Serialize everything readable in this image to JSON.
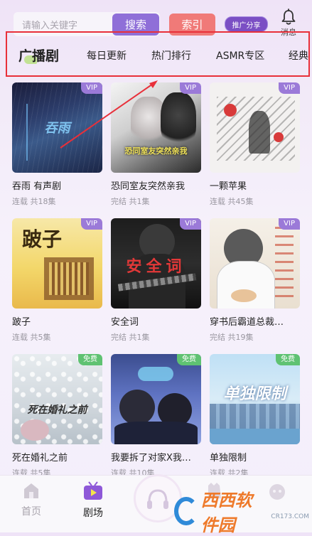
{
  "search": {
    "placeholder": "请输入关键字",
    "button": "搜索"
  },
  "header": {
    "index_button": "索引",
    "share_button": "推广分享",
    "messages_label": "消息"
  },
  "tabs": [
    "广播剧",
    "每日更新",
    "热门排行",
    "ASMR专区",
    "经典"
  ],
  "items": [
    {
      "title": "吞雨 有声剧",
      "status": "连载 共18集",
      "badge": "VIP",
      "cover_text": "吞雨"
    },
    {
      "title": "恐同室友突然亲我",
      "status": "完结 共1集",
      "badge": "VIP",
      "cover_text": "恐同室友突然亲我"
    },
    {
      "title": "一颗苹果",
      "status": "连载 共45集",
      "badge": "VIP",
      "cover_text": ""
    },
    {
      "title": "跛子",
      "status": "连载 共5集",
      "badge": "VIP",
      "cover_text": "跛子"
    },
    {
      "title": "安全词",
      "status": "完结 共1集",
      "badge": "VIP",
      "cover_text": "安全词"
    },
    {
      "title": "穿书后霸道总裁…",
      "status": "完结 共19集",
      "badge": "VIP",
      "cover_text": ""
    },
    {
      "title": "死在婚礼之前",
      "status": "连载 共5集",
      "badge": "免费",
      "cover_text": "死在婚礼之前"
    },
    {
      "title": "我要拆了对家X我…",
      "status": "连载 共10集",
      "badge": "免费",
      "cover_text": ""
    },
    {
      "title": "单独限制",
      "status": "连载 共2集",
      "badge": "免费",
      "cover_text": "单独限制"
    }
  ],
  "nav": {
    "home": "首页",
    "theater": "剧场"
  },
  "watermark": {
    "text": "西西软件园",
    "sub": "CR173.COM"
  }
}
